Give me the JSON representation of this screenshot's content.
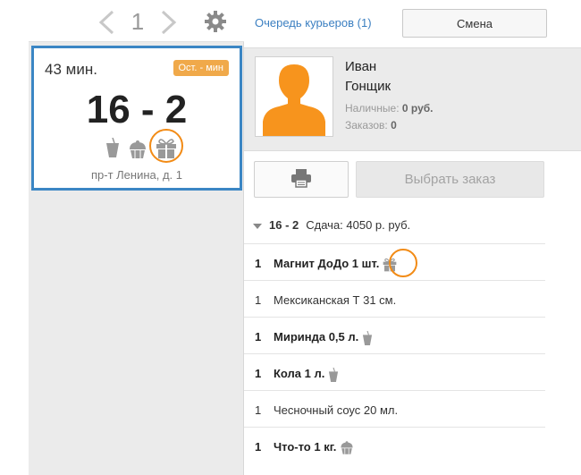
{
  "pager": {
    "page": "1"
  },
  "order_card": {
    "time": "43 мин.",
    "badge": "Ост. - мин",
    "number": "16 - 2",
    "address": "пр-т Ленина, д. 1"
  },
  "header": {
    "queue_link": "Очередь курьеров (1)",
    "shift_button": "Смена"
  },
  "courier": {
    "first_name": "Иван",
    "last_name": "Гонщик",
    "cash_label": "Наличные:",
    "cash_value": "0 руб.",
    "orders_label": "Заказов:",
    "orders_value": "0"
  },
  "actions": {
    "choose_order": "Выбрать заказ"
  },
  "order": {
    "number": "16 - 2",
    "change": "Сдача: 4050 р. руб."
  },
  "items": [
    {
      "qty": "1",
      "name": "Магнит ДоДо 1 шт.",
      "bold": true,
      "icon": "gift-icon"
    },
    {
      "qty": "1",
      "name": "Мексиканская Т 31 см.",
      "bold": false,
      "icon": ""
    },
    {
      "qty": "1",
      "name": "Миринда 0,5 л.",
      "bold": true,
      "icon": "cup-icon"
    },
    {
      "qty": "1",
      "name": "Кола 1 л.",
      "bold": true,
      "icon": "cup-icon"
    },
    {
      "qty": "1",
      "name": "Чесночный соус 20 мл.",
      "bold": false,
      "icon": ""
    },
    {
      "qty": "1",
      "name": "Что-то 1 кг.",
      "bold": true,
      "icon": "cake-icon"
    }
  ],
  "colors": {
    "accent_blue": "#3b86c4",
    "badge_orange": "#f0a94a",
    "highlight_ring": "#f28b16",
    "avatar_orange": "#f7941d"
  }
}
